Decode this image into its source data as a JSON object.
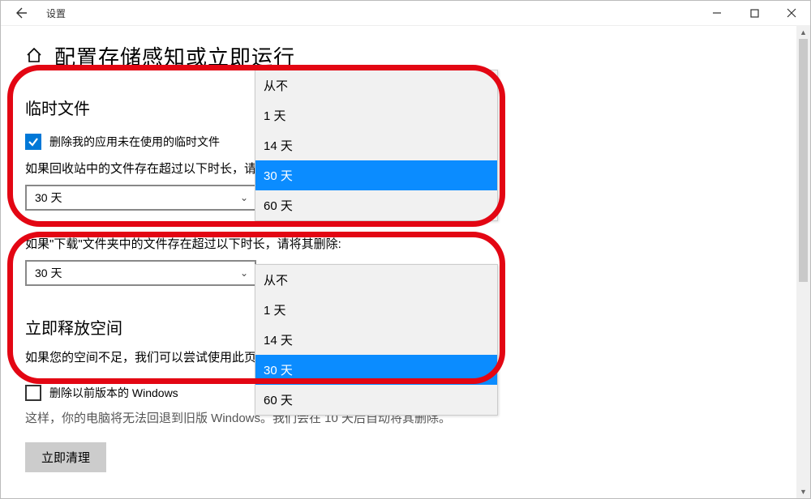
{
  "titlebar": {
    "title": "设置"
  },
  "page": {
    "heading": "配置存储感知或立即运行",
    "temp_section_title": "临时文件",
    "checkbox_label": "删除我的应用未在使用的临时文件",
    "recycle_text": "如果回收站中的文件存在超过以下时长，请将其删除:",
    "recycle_combo_value": "30 天",
    "downloads_text": "如果\"下载\"文件夹中的文件存在超过以下时长，请将其删除:",
    "downloads_combo_value": "30 天",
    "freespace_title": "立即释放空间",
    "freespace_hint": "如果您的空间不足，我们可以尝试使用此页面",
    "prev_windows_checkbox_label": "删除以前版本的 Windows",
    "prev_windows_note": "这样，你的电脑将无法回退到旧版 Windows。我们会在 10 天后自动将其删除。",
    "clean_now_button": "立即清理"
  },
  "dropdown_options": {
    "0": "从不",
    "1": "1 天",
    "2": "14 天",
    "3": "30 天",
    "4": "60 天"
  }
}
